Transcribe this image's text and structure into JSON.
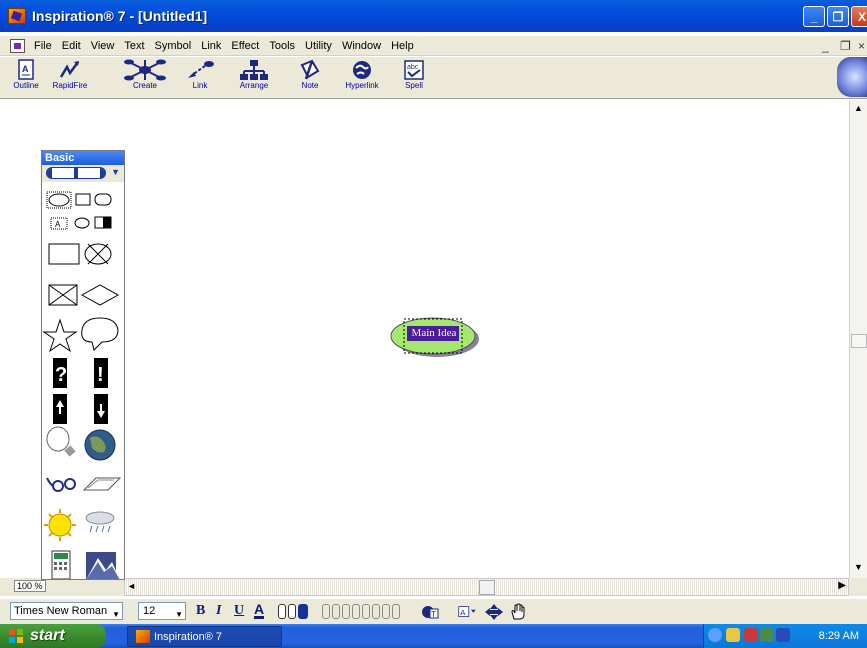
{
  "window": {
    "title": "Inspiration® 7 - [Untitled1]",
    "min": "_",
    "max": "❐",
    "close": "X"
  },
  "menu": {
    "items": [
      "File",
      "Edit",
      "View",
      "Text",
      "Symbol",
      "Link",
      "Effect",
      "Tools",
      "Utility",
      "Window",
      "Help"
    ],
    "mdi_min": "_",
    "mdi_restore": "❐",
    "mdi_close": "×"
  },
  "toolbar": {
    "buttons": [
      "Outline",
      "RapidFire",
      "Create",
      "Link",
      "Arrange",
      "Note",
      "Hyperlink",
      "Spell"
    ]
  },
  "palette": {
    "title": "Basic"
  },
  "canvas": {
    "node_text": "Main Idea"
  },
  "status": {
    "zoom": "100 %"
  },
  "format": {
    "font": "Times New Roman",
    "size": "12",
    "bold": "B",
    "italic": "I",
    "underline": "U",
    "text_color": "A"
  },
  "taskbar": {
    "start": "start",
    "task": "Inspiration® 7",
    "clock": "8:29 AM"
  },
  "colors": {
    "title_blue": "#0454e0",
    "node_fill": "#a6e86e",
    "node_text_bg": "#4b1b9e"
  }
}
